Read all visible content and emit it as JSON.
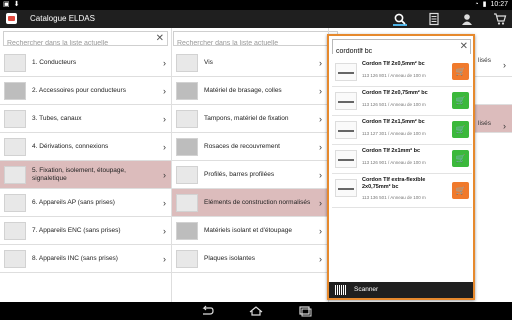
{
  "statusbar": {
    "left_icons": [
      "gallery-icon",
      "download-icon"
    ],
    "time": "10:27"
  },
  "app": {
    "title": "Catalogue ELDAS"
  },
  "search_left": {
    "placeholder": "Rechercher dans la liste actuelle"
  },
  "search_middle": {
    "placeholder": "Rechercher dans la liste actuelle"
  },
  "categories": [
    {
      "label": "1. Conducteurs"
    },
    {
      "label": "2. Accessoires pour conducteurs"
    },
    {
      "label": "3. Tubes, canaux"
    },
    {
      "label": "4. Dérivations, connexions"
    },
    {
      "label": "5. Fixation, isolement, étoupage, signaletique",
      "selected": true
    },
    {
      "label": "6. Appareils AP (sans prises)"
    },
    {
      "label": "7. Appareils ENC (sans prises)"
    },
    {
      "label": "8. Appareils INC (sans prises)"
    }
  ],
  "subcategories": [
    {
      "label": "Vis"
    },
    {
      "label": "Matériel de brasage, colles"
    },
    {
      "label": "Tampons, matériel de fixation"
    },
    {
      "label": "Rosaces de recouvrement"
    },
    {
      "label": "Profilés, barres profilées"
    },
    {
      "label": "Eléments de construction normalisés",
      "selected": true
    },
    {
      "label": "Matériels isolant et d'étoupage"
    },
    {
      "label": "Plaques isolantes"
    }
  ],
  "third_col": {
    "row1": "lisés",
    "row3": "lisés"
  },
  "popup": {
    "query": "cordontlf bc",
    "results": [
      {
        "name": "Cordon Tlf 2x0,5mm² bc",
        "ref": "113 126 801 / Anneau de 100 m",
        "cart": "orange"
      },
      {
        "name": "Cordon Tlf 2x0,75mm² bc",
        "ref": "113 126 501 / Anneau de 100 m",
        "cart": "green"
      },
      {
        "name": "Cordon Tlf 2x1,5mm² bc",
        "ref": "113 127 301 / Anneau de 100 m",
        "cart": "green"
      },
      {
        "name": "Cordon Tlf 2x1mm² bc",
        "ref": "113 126 901 / Anneau de 100 m",
        "cart": "green"
      },
      {
        "name": "Cordon Tlf extra-flexible 2x0,75mm² bc",
        "ref": "113 136 501 / Anneau de 100 m",
        "cart": "orange"
      }
    ],
    "scanner_label": "Scanner"
  },
  "colors": {
    "accent": "#e6892d",
    "selected_row": "#dcbcbc",
    "cart_green": "#3bb83b",
    "cart_orange": "#f07a2c"
  }
}
